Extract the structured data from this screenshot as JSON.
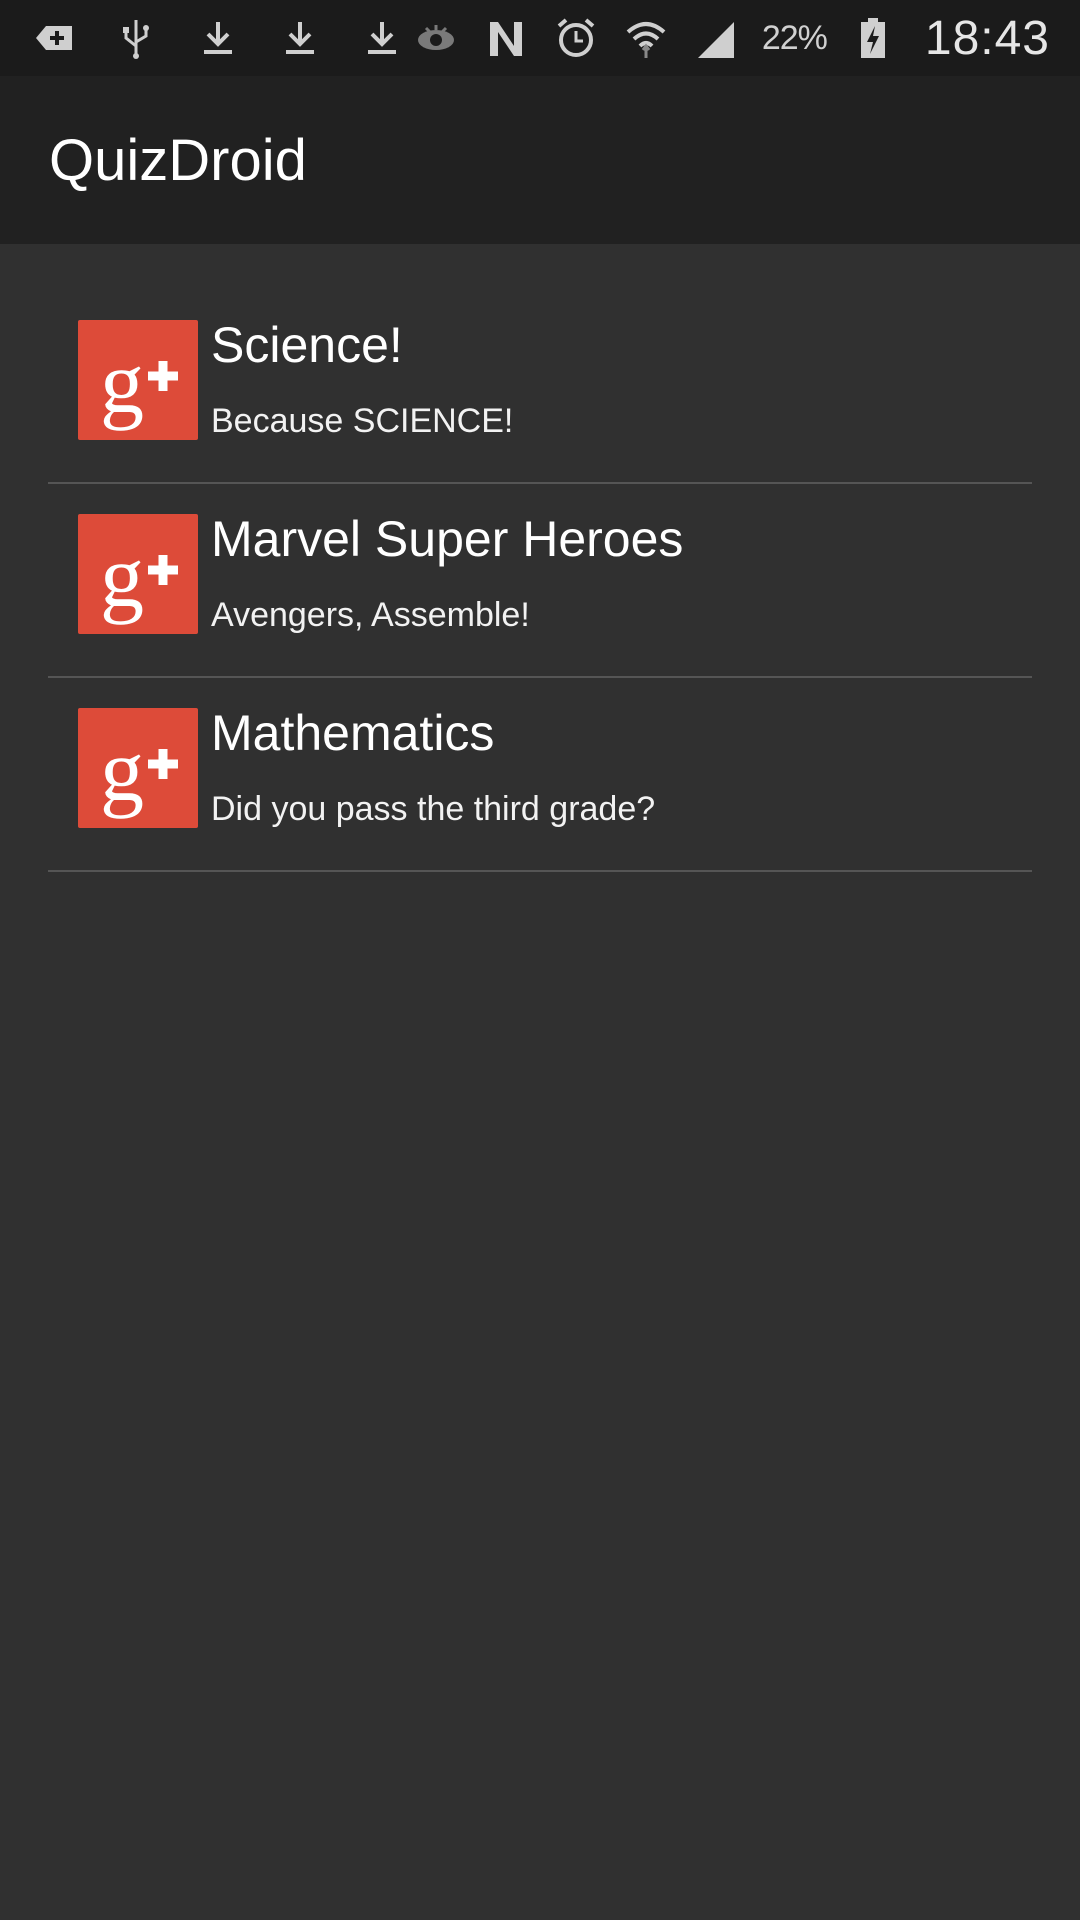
{
  "status_bar": {
    "left_icons": [
      "add-notification-icon",
      "usb-icon",
      "download-icon",
      "download-icon",
      "download-icon"
    ],
    "right_icons": [
      "eye-icon",
      "nfc-icon",
      "alarm-icon",
      "wifi-icon",
      "signal-icon"
    ],
    "battery_percent": "22%",
    "time": "18:43"
  },
  "action_bar": {
    "title": "QuizDroid"
  },
  "quizzes": [
    {
      "title": "Science!",
      "description": "Because SCIENCE!",
      "icon": "google-plus-icon"
    },
    {
      "title": "Marvel Super Heroes",
      "description": "Avengers, Assemble!",
      "icon": "google-plus-icon"
    },
    {
      "title": "Mathematics",
      "description": "Did you pass the third grade?",
      "icon": "google-plus-icon"
    }
  ],
  "colors": {
    "background": "#303030",
    "action_bar": "#212121",
    "status_bar": "#1b1b1b",
    "icon_red": "#dd4b39",
    "divider": "#555555"
  }
}
